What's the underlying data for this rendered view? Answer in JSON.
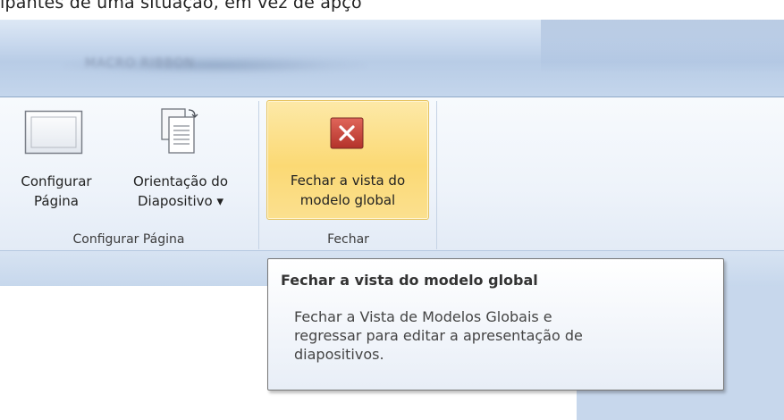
{
  "top_strip": {
    "cut_text": "ipantes de uma situação, em vez de apçõ"
  },
  "titlebar": {
    "blurred_text": "MACRO RIBBON"
  },
  "ribbon": {
    "groups": [
      {
        "label": "Configurar Página",
        "buttons": [
          {
            "line1": "Configurar",
            "line2": "Página",
            "icon": "page-setup-icon"
          },
          {
            "line1": "Orientação do",
            "line2": "Diapositivo ▾",
            "icon": "slide-orientation-icon"
          }
        ]
      },
      {
        "label": "Fechar",
        "buttons": [
          {
            "line1": "Fechar a vista do",
            "line2": "modelo global",
            "icon": "close-master-view-icon"
          }
        ]
      }
    ]
  },
  "tooltip": {
    "title": "Fechar a vista do modelo global",
    "body_lines": [
      "Fechar a Vista de Modelos Globais e",
      "regressar para editar a apresentação de",
      "diapositivos."
    ]
  },
  "colors": {
    "ribbon_bg": "#eef3fa",
    "active_button": "#fbd974",
    "close_icon_red": "#c8443a"
  }
}
